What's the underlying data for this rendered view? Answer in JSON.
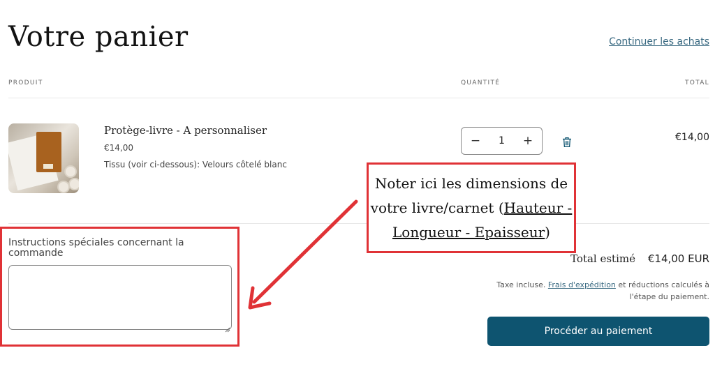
{
  "header": {
    "title": "Votre panier",
    "continue_link": "Continuer les achats"
  },
  "table": {
    "columns": [
      "PRODUIT",
      "QUANTITÉ",
      "TOTAL"
    ]
  },
  "item": {
    "name": "Protège-livre - A personnaliser",
    "price": "€14,00",
    "variant": "Tissu (voir ci-dessous): Velours côtelé blanc",
    "quantity": "1",
    "minus": "−",
    "plus": "+",
    "line_total": "€14,00",
    "remove_icon": "trash-icon"
  },
  "callout": {
    "line1": "Noter ici les dimensions de",
    "line2_prefix": "votre livre/carnet (",
    "line2_link": "Hauteur -",
    "line3_link": "Longueur - Epaisseur",
    "line3_suffix": ")"
  },
  "notes": {
    "label": "Instructions spéciales concernant la commande",
    "value": ""
  },
  "summary": {
    "total_label": "Total estimé",
    "total_value": "€14,00 EUR",
    "tax_prefix": "Taxe incluse.",
    "shipping_link": "Frais d'expédition",
    "tax_suffix": "et réductions calculés à l'étape du paiement.",
    "checkout_label": "Procéder au paiement"
  },
  "colors": {
    "accent": "#0e5470",
    "link": "#3a6a82",
    "annotation": "#e03236"
  }
}
